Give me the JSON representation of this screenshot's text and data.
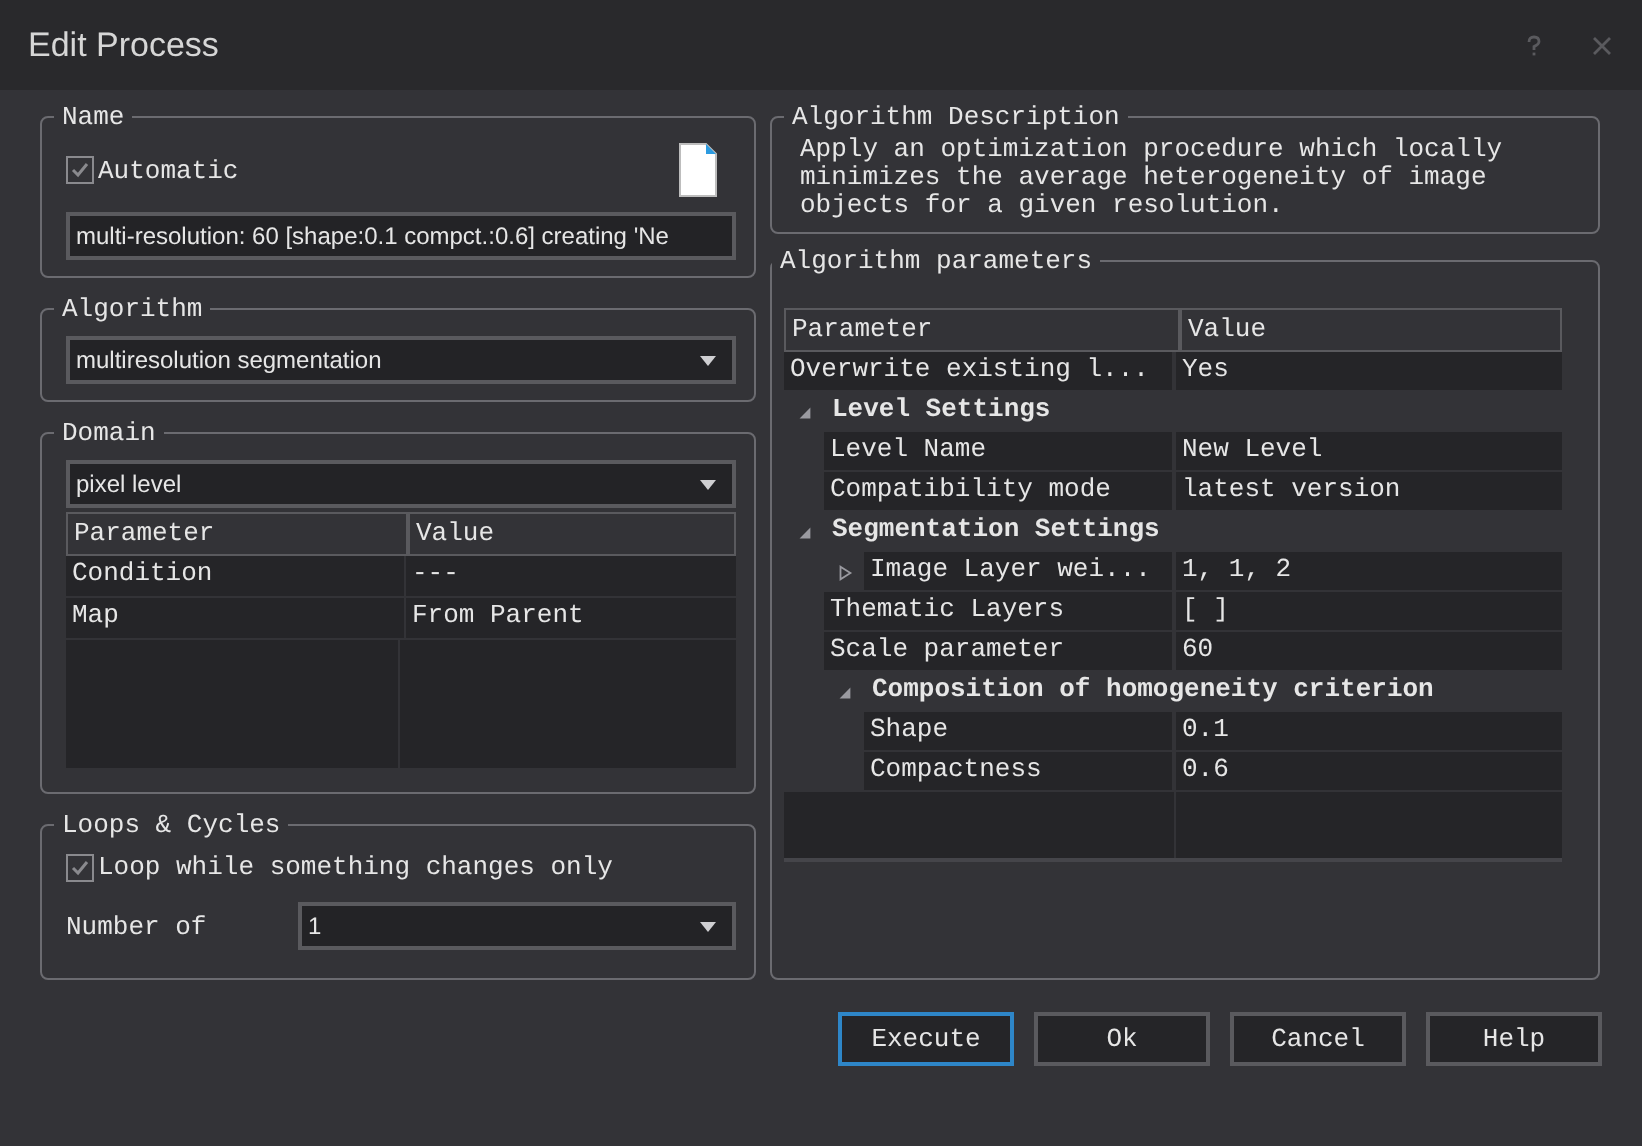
{
  "window": {
    "title": "Edit Process"
  },
  "name_group": {
    "legend": "Name",
    "automatic": {
      "label": "Automatic",
      "checked": true
    },
    "value": "multi-resolution: 60 [shape:0.1 compct.:0.6] creating 'Ne"
  },
  "algorithm_group": {
    "legend": "Algorithm",
    "value": "multiresolution segmentation"
  },
  "domain_group": {
    "legend": "Domain",
    "value": "pixel level",
    "columns": [
      "Parameter",
      "Value"
    ],
    "rows": [
      {
        "parameter": "Condition",
        "value": "---"
      },
      {
        "parameter": "Map",
        "value": "From Parent"
      }
    ]
  },
  "loops_group": {
    "legend": "Loops & Cycles",
    "loop": {
      "label": "Loop while something changes only",
      "checked": true
    },
    "number_label": "Number of",
    "number_value": "1"
  },
  "description_group": {
    "legend": "Algorithm Description",
    "text": "Apply an optimization procedure which locally minimizes the average heterogeneity of image objects for a given resolution."
  },
  "parameters_group": {
    "legend": "Algorithm parameters",
    "columns": [
      "Parameter",
      "Value"
    ],
    "rows": [
      {
        "kind": "param",
        "name": "Overwrite existing l...",
        "value": "Yes"
      },
      {
        "kind": "group",
        "name": "Level Settings",
        "expanded": true,
        "children": [
          {
            "kind": "param",
            "name": "Level Name",
            "value": "New Level"
          },
          {
            "kind": "param",
            "name": "Compatibility mode",
            "value": "latest version"
          }
        ]
      },
      {
        "kind": "group",
        "name": "Segmentation Settings",
        "expanded": true,
        "children": [
          {
            "kind": "param",
            "name": "Image Layer wei...",
            "value": "1, 1, 2",
            "expanded": false
          },
          {
            "kind": "param",
            "name": "Thematic Layers",
            "value": "[  ]"
          },
          {
            "kind": "param",
            "name": "Scale parameter",
            "value": "60"
          },
          {
            "kind": "group",
            "name": "Composition of homogeneity criterion",
            "expanded": true,
            "children": [
              {
                "kind": "param",
                "name": "Shape",
                "value": "0.1"
              },
              {
                "kind": "param",
                "name": "Compactness",
                "value": "0.6"
              }
            ]
          }
        ]
      }
    ]
  },
  "buttons": [
    {
      "label": "Execute",
      "selected": true
    },
    {
      "label": "Ok",
      "selected": false
    },
    {
      "label": "Cancel",
      "selected": false
    },
    {
      "label": "Help",
      "selected": false
    }
  ]
}
